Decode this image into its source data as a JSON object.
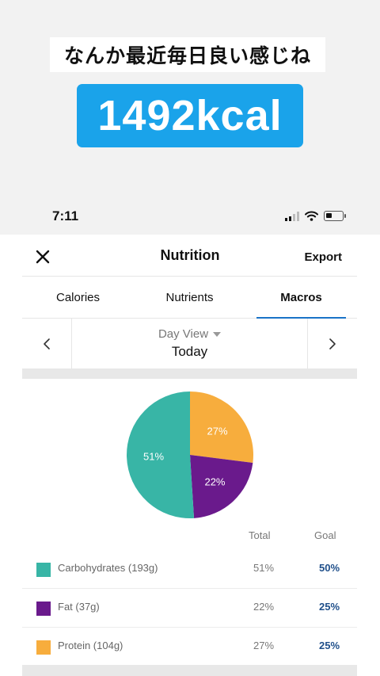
{
  "caption": {
    "text": "なんか最近毎日良い感じね",
    "kcal": "1492kcal"
  },
  "status_bar": {
    "time": "7:11"
  },
  "header": {
    "title": "Nutrition",
    "export_label": "Export",
    "close_icon": "close-icon"
  },
  "tabs": [
    {
      "label": "Calories",
      "active": false
    },
    {
      "label": "Nutrients",
      "active": false
    },
    {
      "label": "Macros",
      "active": true
    }
  ],
  "day_nav": {
    "view_label": "Day View",
    "date_label": "Today",
    "prev_icon": "chevron-left-icon",
    "next_icon": "chevron-right-icon"
  },
  "columns": {
    "total": "Total",
    "goal": "Goal"
  },
  "macros": [
    {
      "name": "Carbohydrates (193g)",
      "total": "51%",
      "goal": "50%",
      "color": "#38b5a6"
    },
    {
      "name": "Fat (37g)",
      "total": "22%",
      "goal": "25%",
      "color": "#6a1a8c"
    },
    {
      "name": "Protein (104g)",
      "total": "27%",
      "goal": "25%",
      "color": "#f7ad3d"
    }
  ],
  "chart_data": {
    "type": "pie",
    "slices": [
      {
        "label": "Protein",
        "value": 27,
        "display": "27%",
        "color": "#f7ad3d"
      },
      {
        "label": "Fat",
        "value": 22,
        "display": "22%",
        "color": "#6a1a8c"
      },
      {
        "label": "Carbohydrates",
        "value": 51,
        "display": "51%",
        "color": "#38b5a6"
      }
    ]
  }
}
